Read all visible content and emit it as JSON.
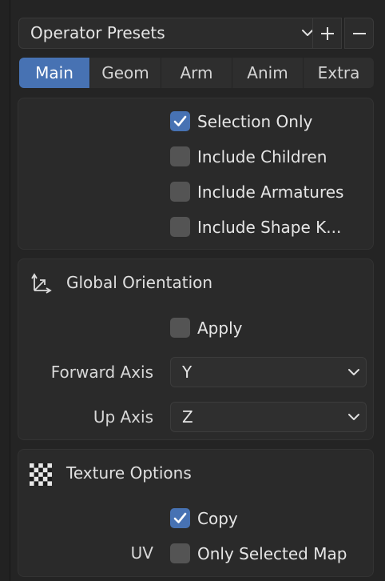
{
  "presets": {
    "label": "Operator Presets",
    "add_icon": "plus-icon",
    "remove_icon": "minus-icon"
  },
  "tabs": [
    {
      "label": "Main",
      "active": true
    },
    {
      "label": "Geom",
      "active": false
    },
    {
      "label": "Arm",
      "active": false
    },
    {
      "label": "Anim",
      "active": false
    },
    {
      "label": "Extra",
      "active": false
    }
  ],
  "include": {
    "options": [
      {
        "label": "Selection Only",
        "checked": true
      },
      {
        "label": "Include Children",
        "checked": false
      },
      {
        "label": "Include Armatures",
        "checked": false
      },
      {
        "label": "Include Shape K...",
        "checked": false
      }
    ]
  },
  "orientation": {
    "title": "Global Orientation",
    "icon": "orientation-axes-icon",
    "apply": {
      "label": "Apply",
      "checked": false
    },
    "forward_axis": {
      "label": "Forward Axis",
      "value": "Y"
    },
    "up_axis": {
      "label": "Up Axis",
      "value": "Z"
    }
  },
  "texture": {
    "title": "Texture Options",
    "icon": "checker-texture-icon",
    "copy": {
      "label": "Copy",
      "checked": true
    },
    "uv": {
      "prefix": "UV",
      "label": "Only Selected Map",
      "checked": false
    }
  },
  "colors": {
    "accent": "#4772b3",
    "panel": "#2a2a2a",
    "background": "#242424"
  }
}
